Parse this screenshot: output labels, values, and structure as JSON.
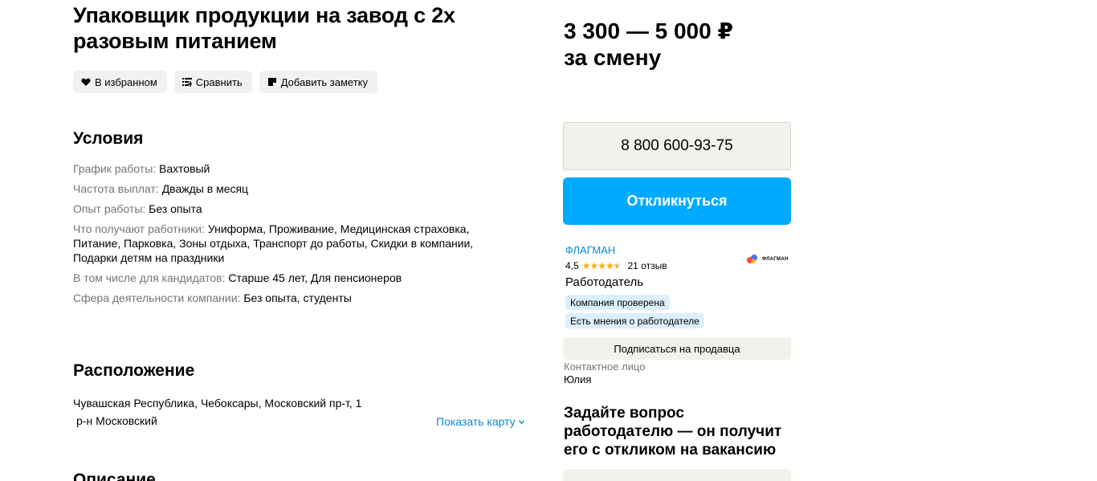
{
  "vacancy": {
    "title": "Упаковщик продукции на завод с 2х разовым питанием"
  },
  "actions": {
    "favorite": "В избранном",
    "compare": "Сравнить",
    "note": "Добавить заметку"
  },
  "conditions": {
    "heading": "Условия",
    "rows": [
      {
        "label": "График работы:",
        "value": "Вахтовый"
      },
      {
        "label": "Частота выплат:",
        "value": "Дважды в месяц"
      },
      {
        "label": "Опыт работы:",
        "value": "Без опыта"
      },
      {
        "label": "Что получают работники:",
        "value": "Униформа, Проживание, Медицинская страховка, Питание, Парковка, Зоны отдыха, Транспорт до работы, Скидки в компании, Подарки детям на праздники"
      },
      {
        "label": "В том числе для кандидатов:",
        "value": "Старше 45 лет, Для пенсионеров"
      },
      {
        "label": "Сфера деятельности компании:",
        "value": "Без опыта, студенты"
      }
    ]
  },
  "location": {
    "heading": "Расположение",
    "address": "Чувашская Республика, Чебоксары, Московский пр-т, 1",
    "district": "р-н Московский",
    "map_link": "Показать карту"
  },
  "description": {
    "heading": "Описание"
  },
  "salary": {
    "range": "3 300 — 5 000 ₽",
    "period": "за смену"
  },
  "contact": {
    "phone": "8 800 600-93-75",
    "respond_button": "Откликнуться",
    "subscribe_button": "Подписаться на продавца",
    "contact_label": "Контактное лицо",
    "contact_name": "Юлия"
  },
  "company": {
    "name": "ФЛАГМАН",
    "rating": "4,5",
    "rating_value": 4.5,
    "reviews": "21 отзыв",
    "role": "Работодатель",
    "badges": [
      "Компания проверена",
      "Есть мнения о работодателе"
    ],
    "logo_text": "ФЛАГМАН"
  },
  "question": {
    "heading": "Задайте вопрос работодателю — он получит его с откликом на вакансию"
  },
  "colors": {
    "accent": "#00aaff",
    "link": "#0a8bd6",
    "star": "#ffa800",
    "badge_bg": "#dcf0fb"
  }
}
